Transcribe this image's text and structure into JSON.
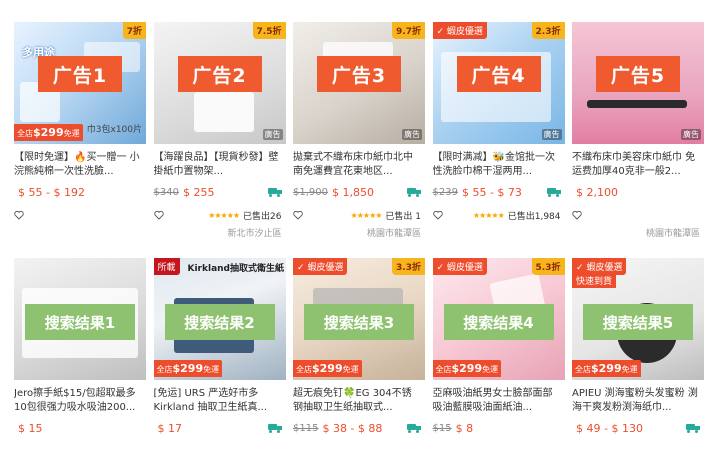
{
  "ads": [
    {
      "overlay": "广告1",
      "corner_tag": "7折",
      "image_caption": "多用途",
      "ship_prefix": "全店",
      "ship_amount": "$299",
      "ship_suffix": "免運",
      "image_side_text": "巾3包x100片",
      "ad_mark": "",
      "title": "【限时免運】🔥买一贈一 小浣熊純棉一次性洗臉...",
      "old_price": "",
      "price": "$ 55 - $ 192",
      "stars": "",
      "sold": "",
      "location": ""
    },
    {
      "overlay": "广告2",
      "corner_tag": "7.5折",
      "ad_mark": "廣告",
      "title": "【海躍良品】【現貨秒發】壁掛紙巾置物架...",
      "old_price": "$340",
      "price": "$ 255",
      "stars": "★★★★★",
      "sold": "已售出26",
      "location": "新北市汐止區"
    },
    {
      "overlay": "广告3",
      "corner_tag": "9.7折",
      "ad_mark": "廣告",
      "title": "拋棄式不織布床巾紙巾北中南免運費宜花東地区...",
      "old_price": "$1,900",
      "price": "$ 1,850",
      "stars": "★★★★★",
      "sold": "已售出 1",
      "location": "桃園市龍潭區"
    },
    {
      "overlay": "广告4",
      "corner_tag": "2.3折",
      "promo_tag": "✓ 蝦皮優選",
      "ad_mark": "廣告",
      "title": "【限时满减】🐝金馆批一次性洗脸巾棉干湿两用...",
      "old_price": "$239",
      "price": "$ 55 - $ 73",
      "stars": "★★★★★",
      "sold": "已售出1,984",
      "location": ""
    },
    {
      "overlay": "广告5",
      "ad_mark": "廣告",
      "title": "不織布床巾美容床巾紙巾 免运费加厚40克非一般2...",
      "old_price": "",
      "price": "$ 2,100",
      "stars": "",
      "sold": "",
      "location": "桃園市龍潭區"
    }
  ],
  "results": [
    {
      "overlay": "搜索结果1",
      "title": "Jero擦手紙$15/包超取最多10包很强力吸水吸油200...",
      "old_price": "",
      "price": "$ 15"
    },
    {
      "overlay": "搜索结果2",
      "promo_tag": "所載",
      "image_caption": "Kirkland抽取式衛生紙",
      "ship_prefix": "全店",
      "ship_amount": "$299",
      "ship_suffix": "免運",
      "title": "[免运] URS 严选好市多 Kirkland 抽取卫生紙真...",
      "old_price": "",
      "price": "$ 17"
    },
    {
      "overlay": "搜索结果3",
      "corner_tag": "3.3折",
      "promo_tag": "✓ 蝦皮優選",
      "ship_prefix": "全店",
      "ship_amount": "$299",
      "ship_suffix": "免運",
      "title": "超无痕免钉🍀EG 304不锈钢抽取卫生纸抽取式...",
      "old_price": "$115",
      "price": "$ 38 - $ 88"
    },
    {
      "overlay": "搜索结果4",
      "corner_tag": "5.3折",
      "promo_tag": "✓ 蝦皮優選",
      "ship_prefix": "全店",
      "ship_amount": "$299",
      "ship_suffix": "免運",
      "title": "亞麻吸油紙男女士臉部面部吸油藍膜吸油面紙油...",
      "old_price": "$15",
      "price": "$ 8"
    },
    {
      "overlay": "搜索结果5",
      "promo_tag": "✓ 蝦皮優選",
      "promo_sub": "快速到貨",
      "ship_prefix": "全店",
      "ship_amount": "$299",
      "ship_suffix": "免運",
      "title": "APIEU 渕海蜜粉头发蜜粉 渕海干爽发粉渕海纸巾...",
      "old_price": "",
      "price": "$ 49 - $ 130"
    }
  ],
  "colors": {
    "price": "#ee4d2d",
    "ad_overlay": "#ef5a2f",
    "result_overlay": "#8fc270",
    "free_shipping_icon": "#26aa99",
    "star": "#f6a700"
  }
}
